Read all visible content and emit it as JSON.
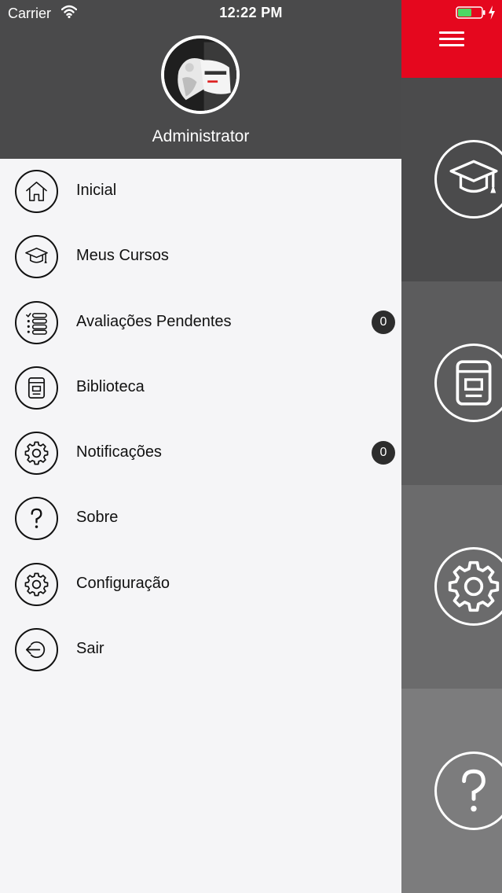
{
  "status_bar": {
    "carrier": "Carrier",
    "time": "12:22 PM",
    "battery_color": "#4cd964"
  },
  "header": {
    "user_name": "Administrator",
    "menu_button_icon": "hamburger-icon",
    "accent_color": "#e5071e"
  },
  "menu": {
    "items": [
      {
        "label": "Inicial",
        "icon": "home-icon"
      },
      {
        "label": "Meus Cursos",
        "icon": "graduation-cap-icon"
      },
      {
        "label": "Avaliações Pendentes",
        "icon": "checklist-icon",
        "badge": "0"
      },
      {
        "label": "Biblioteca",
        "icon": "book-icon"
      },
      {
        "label": "Notificações",
        "icon": "gear-icon",
        "badge": "0"
      },
      {
        "label": "Sobre",
        "icon": "question-icon"
      },
      {
        "label": "Configuração",
        "icon": "gear-icon"
      },
      {
        "label": "Sair",
        "icon": "logout-icon"
      }
    ]
  },
  "background_tiles": [
    {
      "icon": "graduation-cap-icon"
    },
    {
      "icon": "book-icon"
    },
    {
      "icon": "gear-icon"
    },
    {
      "icon": "question-icon"
    }
  ]
}
